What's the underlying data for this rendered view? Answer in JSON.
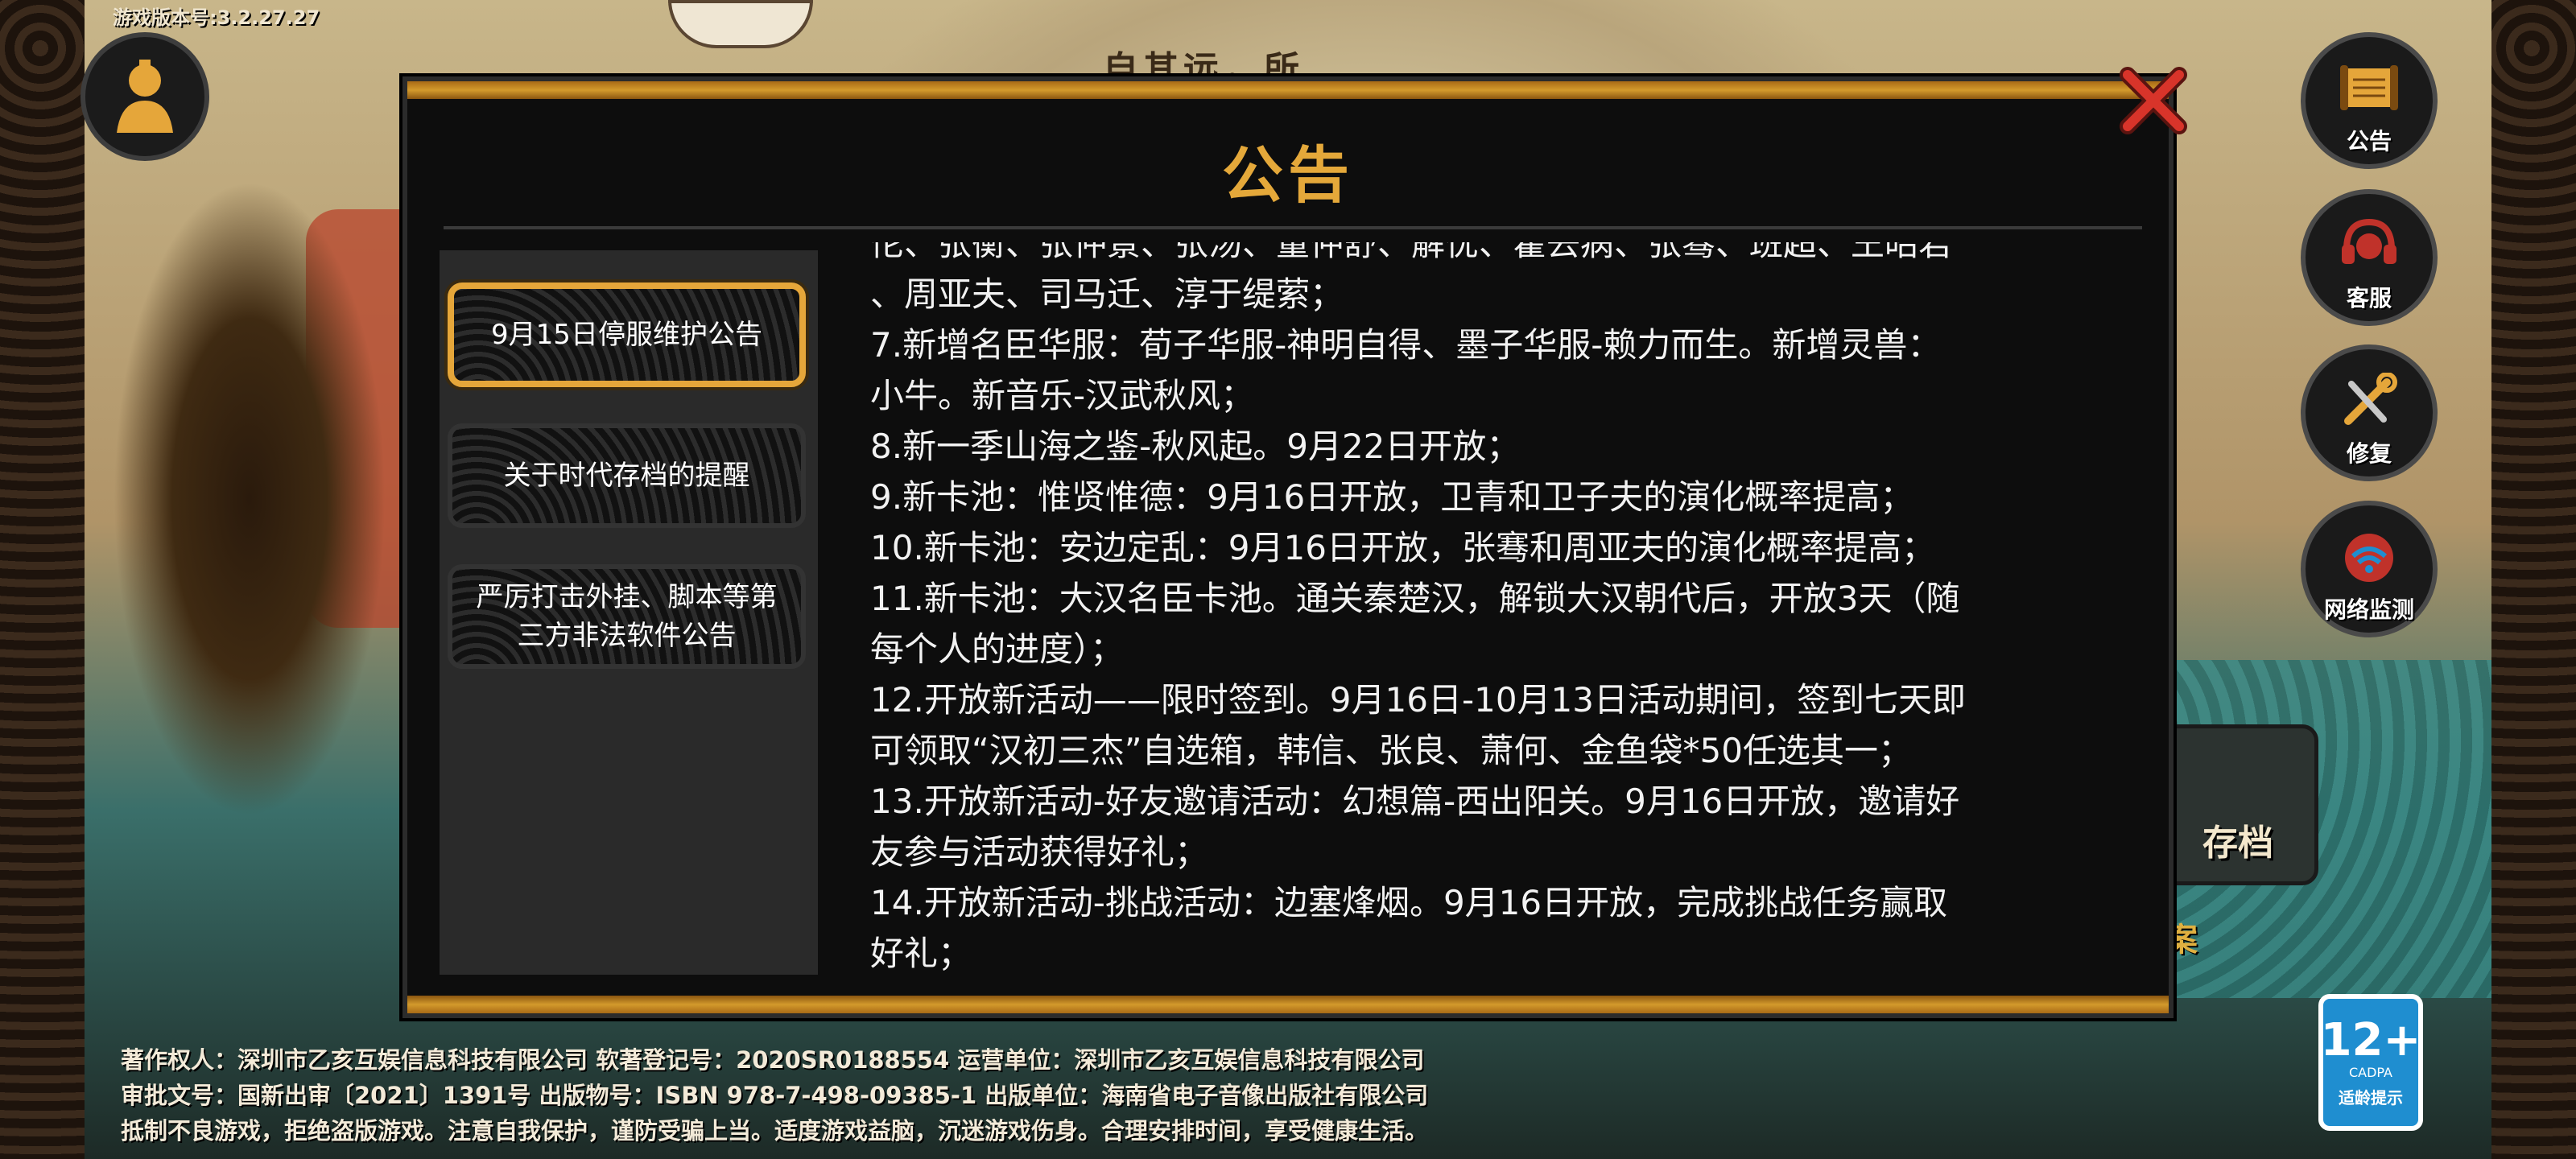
{
  "game": {
    "version_text": "游戏版本号:3.2.27.27",
    "scene_title": "自其远，所"
  },
  "side_buttons": [
    {
      "label": "公告",
      "icon": "scroll-icon"
    },
    {
      "label": "客服",
      "icon": "headset-icon"
    },
    {
      "label": "修复",
      "icon": "wrench-icon"
    },
    {
      "label": "网络监测",
      "icon": "wifi-icon"
    }
  ],
  "storage": {
    "label": "存档",
    "gold_text": "案"
  },
  "legal": {
    "line1": "著作权人：深圳市乙亥互娱信息科技有限公司  软著登记号：2020SR0188554    运营单位：深圳市乙亥互娱信息科技有限公司",
    "line2": "审批文号：国新出审〔2021〕1391号    出版物号：ISBN 978-7-498-09385-1   出版单位：海南省电子音像出版社有限公司",
    "line3": "抵制不良游戏，拒绝盗版游戏。注意自我保护，谨防受骗上当。适度游戏益脑，沉迷游戏伤身。合理安排时间，享受健康生活。"
  },
  "age_rating": {
    "value": "12+",
    "org": "CADPA",
    "tip": "适龄提示"
  },
  "modal": {
    "title": "公告",
    "tabs": [
      {
        "label": "9月15日停服维护公告",
        "active": true
      },
      {
        "label": "关于时代存档的提醒",
        "active": false
      },
      {
        "label": "严厉打击外挂、脚本等第三方非法软件公告",
        "active": false
      }
    ],
    "content_lines": [
      "佗、张衡、张仲景、张汤、董仲舒、解忧、霍去病、张骞、班超、王昭君",
      "、周亚夫、司马迁、淳于缇萦；",
      "7.新增名臣华服：荀子华服-神明自得、墨子华服-赖力而生。新增灵兽：",
      "小牛。新音乐-汉武秋风；",
      "8.新一季山海之鉴-秋风起。9月22日开放；",
      "9.新卡池：惟贤惟德：9月16日开放，卫青和卫子夫的演化概率提高；",
      "10.新卡池：安边定乱：9月16日开放，张骞和周亚夫的演化概率提高；",
      "11.新卡池：大汉名臣卡池。通关秦楚汉，解锁大汉朝代后，开放3天（随",
      "每个人的进度）；",
      "12.开放新活动——限时签到。9月16日-10月13日活动期间，签到七天即",
      "可领取“汉初三杰”自选箱，韩信、张良、萧何、金鱼袋*50任选其一；",
      "13.开放新活动-好友邀请活动：幻想篇-西出阳关。9月16日开放，邀请好",
      "友参与活动获得好礼；",
      "14.开放新活动-挑战活动：边塞烽烟。9月16日开放，完成挑战任务赢取",
      "好礼；"
    ]
  }
}
